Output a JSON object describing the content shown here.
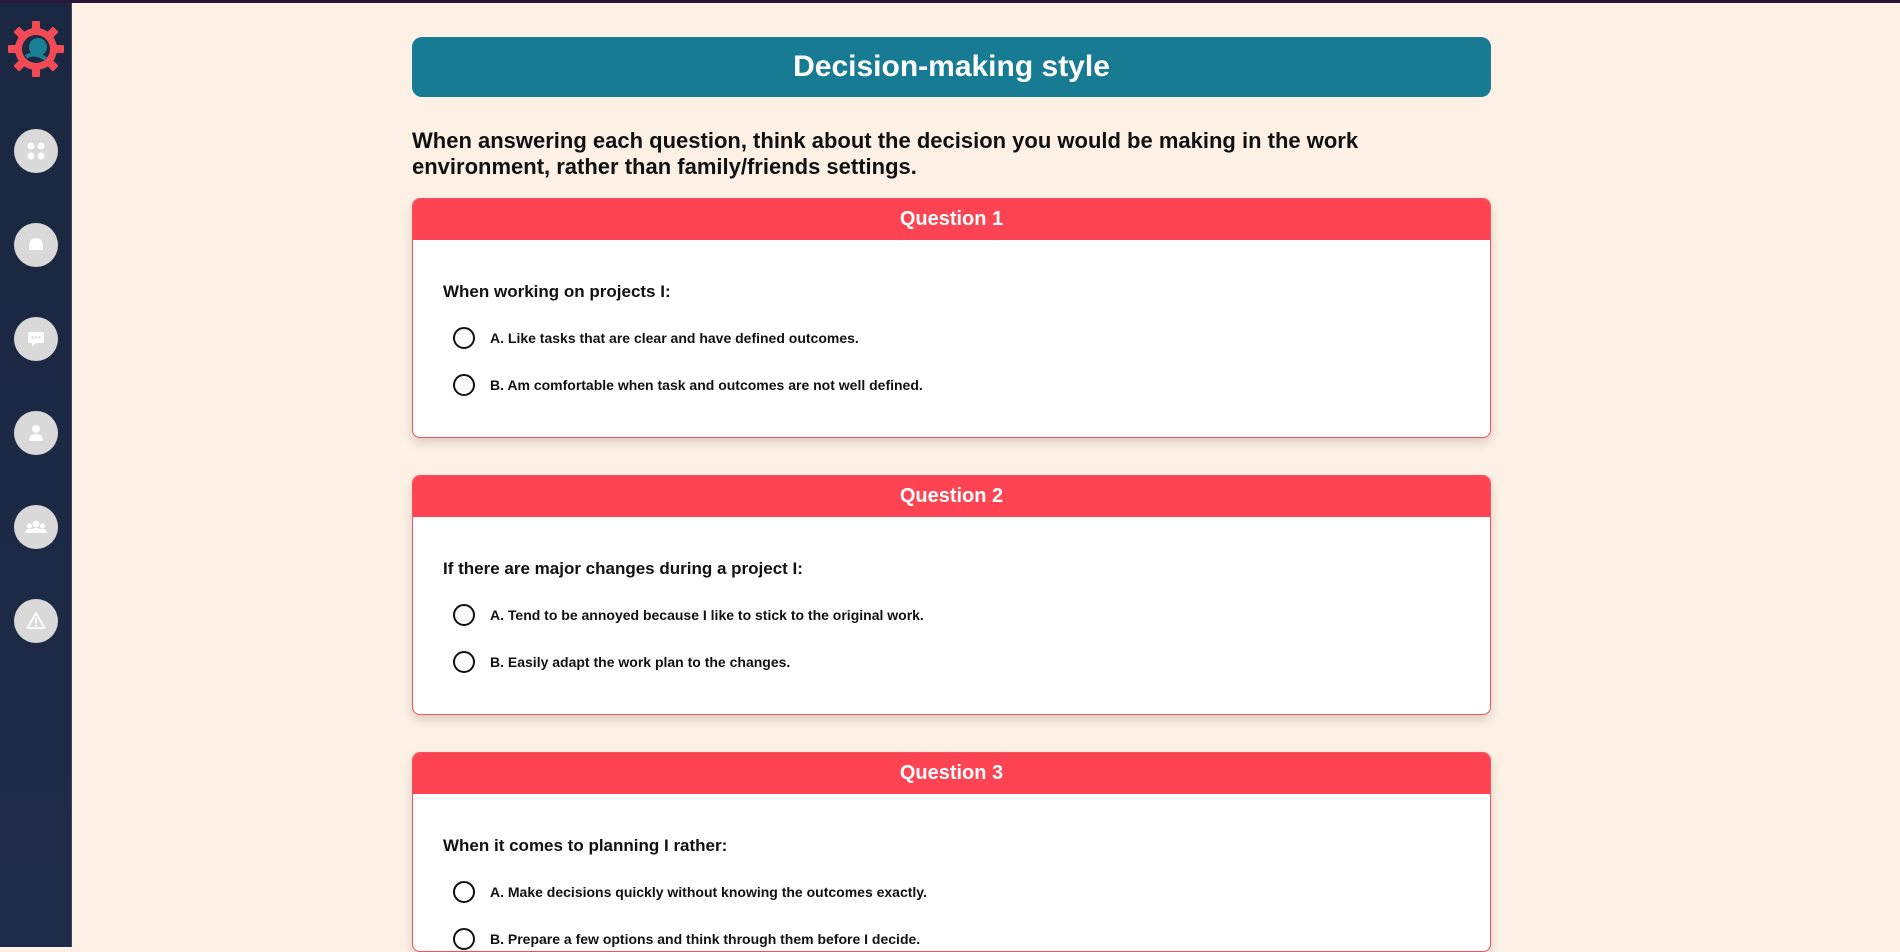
{
  "page": {
    "title": "Decision-making style",
    "instructions": "When answering each question, think about the decision you would be making in the work environment, rather than family/friends settings."
  },
  "sidebar": {
    "logo_icon": "gear-logo-icon",
    "items": [
      {
        "icon": "dashboard-icon"
      },
      {
        "icon": "chat-bubble-icon"
      },
      {
        "icon": "message-icon"
      },
      {
        "icon": "user-icon"
      },
      {
        "icon": "group-icon"
      },
      {
        "icon": "warning-icon"
      }
    ]
  },
  "colors": {
    "title_bar": "#177c93",
    "question_header": "#fe4352",
    "background": "#fdf0e4",
    "sidebar": "#1a2740"
  },
  "questions": [
    {
      "header": "Question 1",
      "text": "When working on projects I:",
      "options": [
        "A. Like tasks that are clear and have defined outcomes.",
        "B. Am comfortable when task and outcomes are not well defined."
      ]
    },
    {
      "header": "Question 2",
      "text": "If there are major changes during a project I:",
      "options": [
        "A. Tend to be annoyed because I like to stick to the original work.",
        "B. Easily adapt the work plan to the changes."
      ]
    },
    {
      "header": "Question 3",
      "text": "When it comes to planning I rather:",
      "options": [
        "A. Make decisions quickly without knowing the outcomes exactly.",
        "B. Prepare a few options and think through them before I decide."
      ]
    }
  ]
}
